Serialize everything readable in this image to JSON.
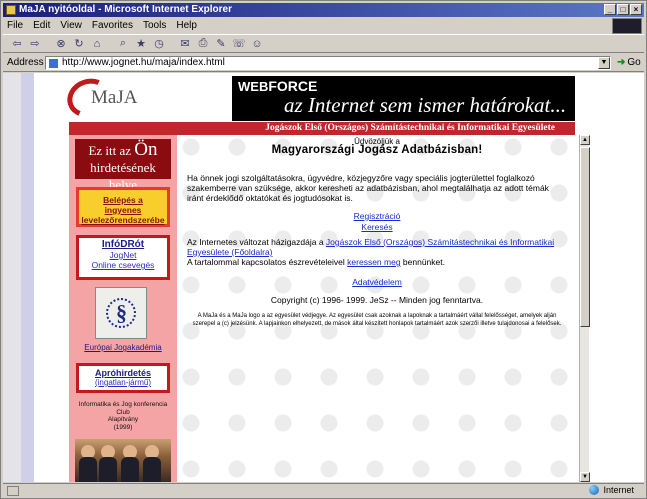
{
  "window": {
    "title": "MaJA nyitóoldal - Microsoft Internet Explorer",
    "controls": [
      "_",
      "□",
      "×"
    ]
  },
  "menu": [
    "File",
    "Edit",
    "View",
    "Favorites",
    "Tools",
    "Help"
  ],
  "address": {
    "label": "Address",
    "url": "http://www.jognet.hu/maja/index.html",
    "go_label": "Go"
  },
  "page": {
    "logo_text": "MaJA",
    "banner": {
      "brand_web": "WEB",
      "brand_force": "FORCE",
      "slogan": "az Internet sem ismer határokat..."
    },
    "org_strip": "Jogászok Első (Országos) Számítástechnikai és Informatikai Egyesülete",
    "sidebar": {
      "ad_line1": "Ez itt az",
      "ad_on": "Ön",
      "ad_line2": "hirdetésének helye",
      "login_title": "Belépés a",
      "login_line2": "ingyenes",
      "login_line3": "levelezőrendszerébe",
      "infodrot_title": "InfóDRót",
      "infodrot_link1": "JogNet",
      "infodrot_link2": "Online csevegés",
      "euro_link": "Európai Jogakadémia",
      "classified_title": "Apróhirdetés",
      "classified_link": "(ingatlan-jármű)",
      "club_line1": "Informatika és Jog konferencia Club",
      "club_line2": "Alapítvány",
      "club_line3": "(1999)"
    },
    "content": {
      "welcome": "Üdvözöljük a",
      "heading": "Magyarországi Jogász Adatbázisban!",
      "intro": "Ha önnek jogi szolgáltatásokra, ügyvédre, közjegyzőre vagy speciális jogterülettel foglalkozó szakemberre van szüksége, akkor keresheti az adatbázisban, ahol megtalálhatja az adott témák iránt érdeklődő oktatókat és jogtudósokat is.",
      "link_registration": "Regisztráció",
      "link_search": "Keresés",
      "inline_prefix": "Az Internetes változat házigazdája a ",
      "inline_link": "Jogászok Első (Országos) Számítástechnikai és Informatikai Egyesülete (Főoldalra)",
      "inline_mid": "A tartalommal kapcsolatos észrevételeivel ",
      "inline_link2": "keressen meg",
      "inline_suffix": " bennünket.",
      "privacy": "Adatvédelem",
      "copyright": "Copyright (c) 1996- 1999. JeSz -- Minden jog fenntartva.",
      "fine_print": "A MaJa és a MaJa logo a az egyesület védjegye. Az egyesület csak azoknak a lapoknak a tartalmáért vállal felelősséget, amelyek alján szerepel a (c) jelzésünk. A lapjainkon elhelyezett, de mások által készített honlapok tartalmáért azok szerzői illetve tulajdonosai a felelősek."
    }
  },
  "status": {
    "zone": "Internet"
  }
}
